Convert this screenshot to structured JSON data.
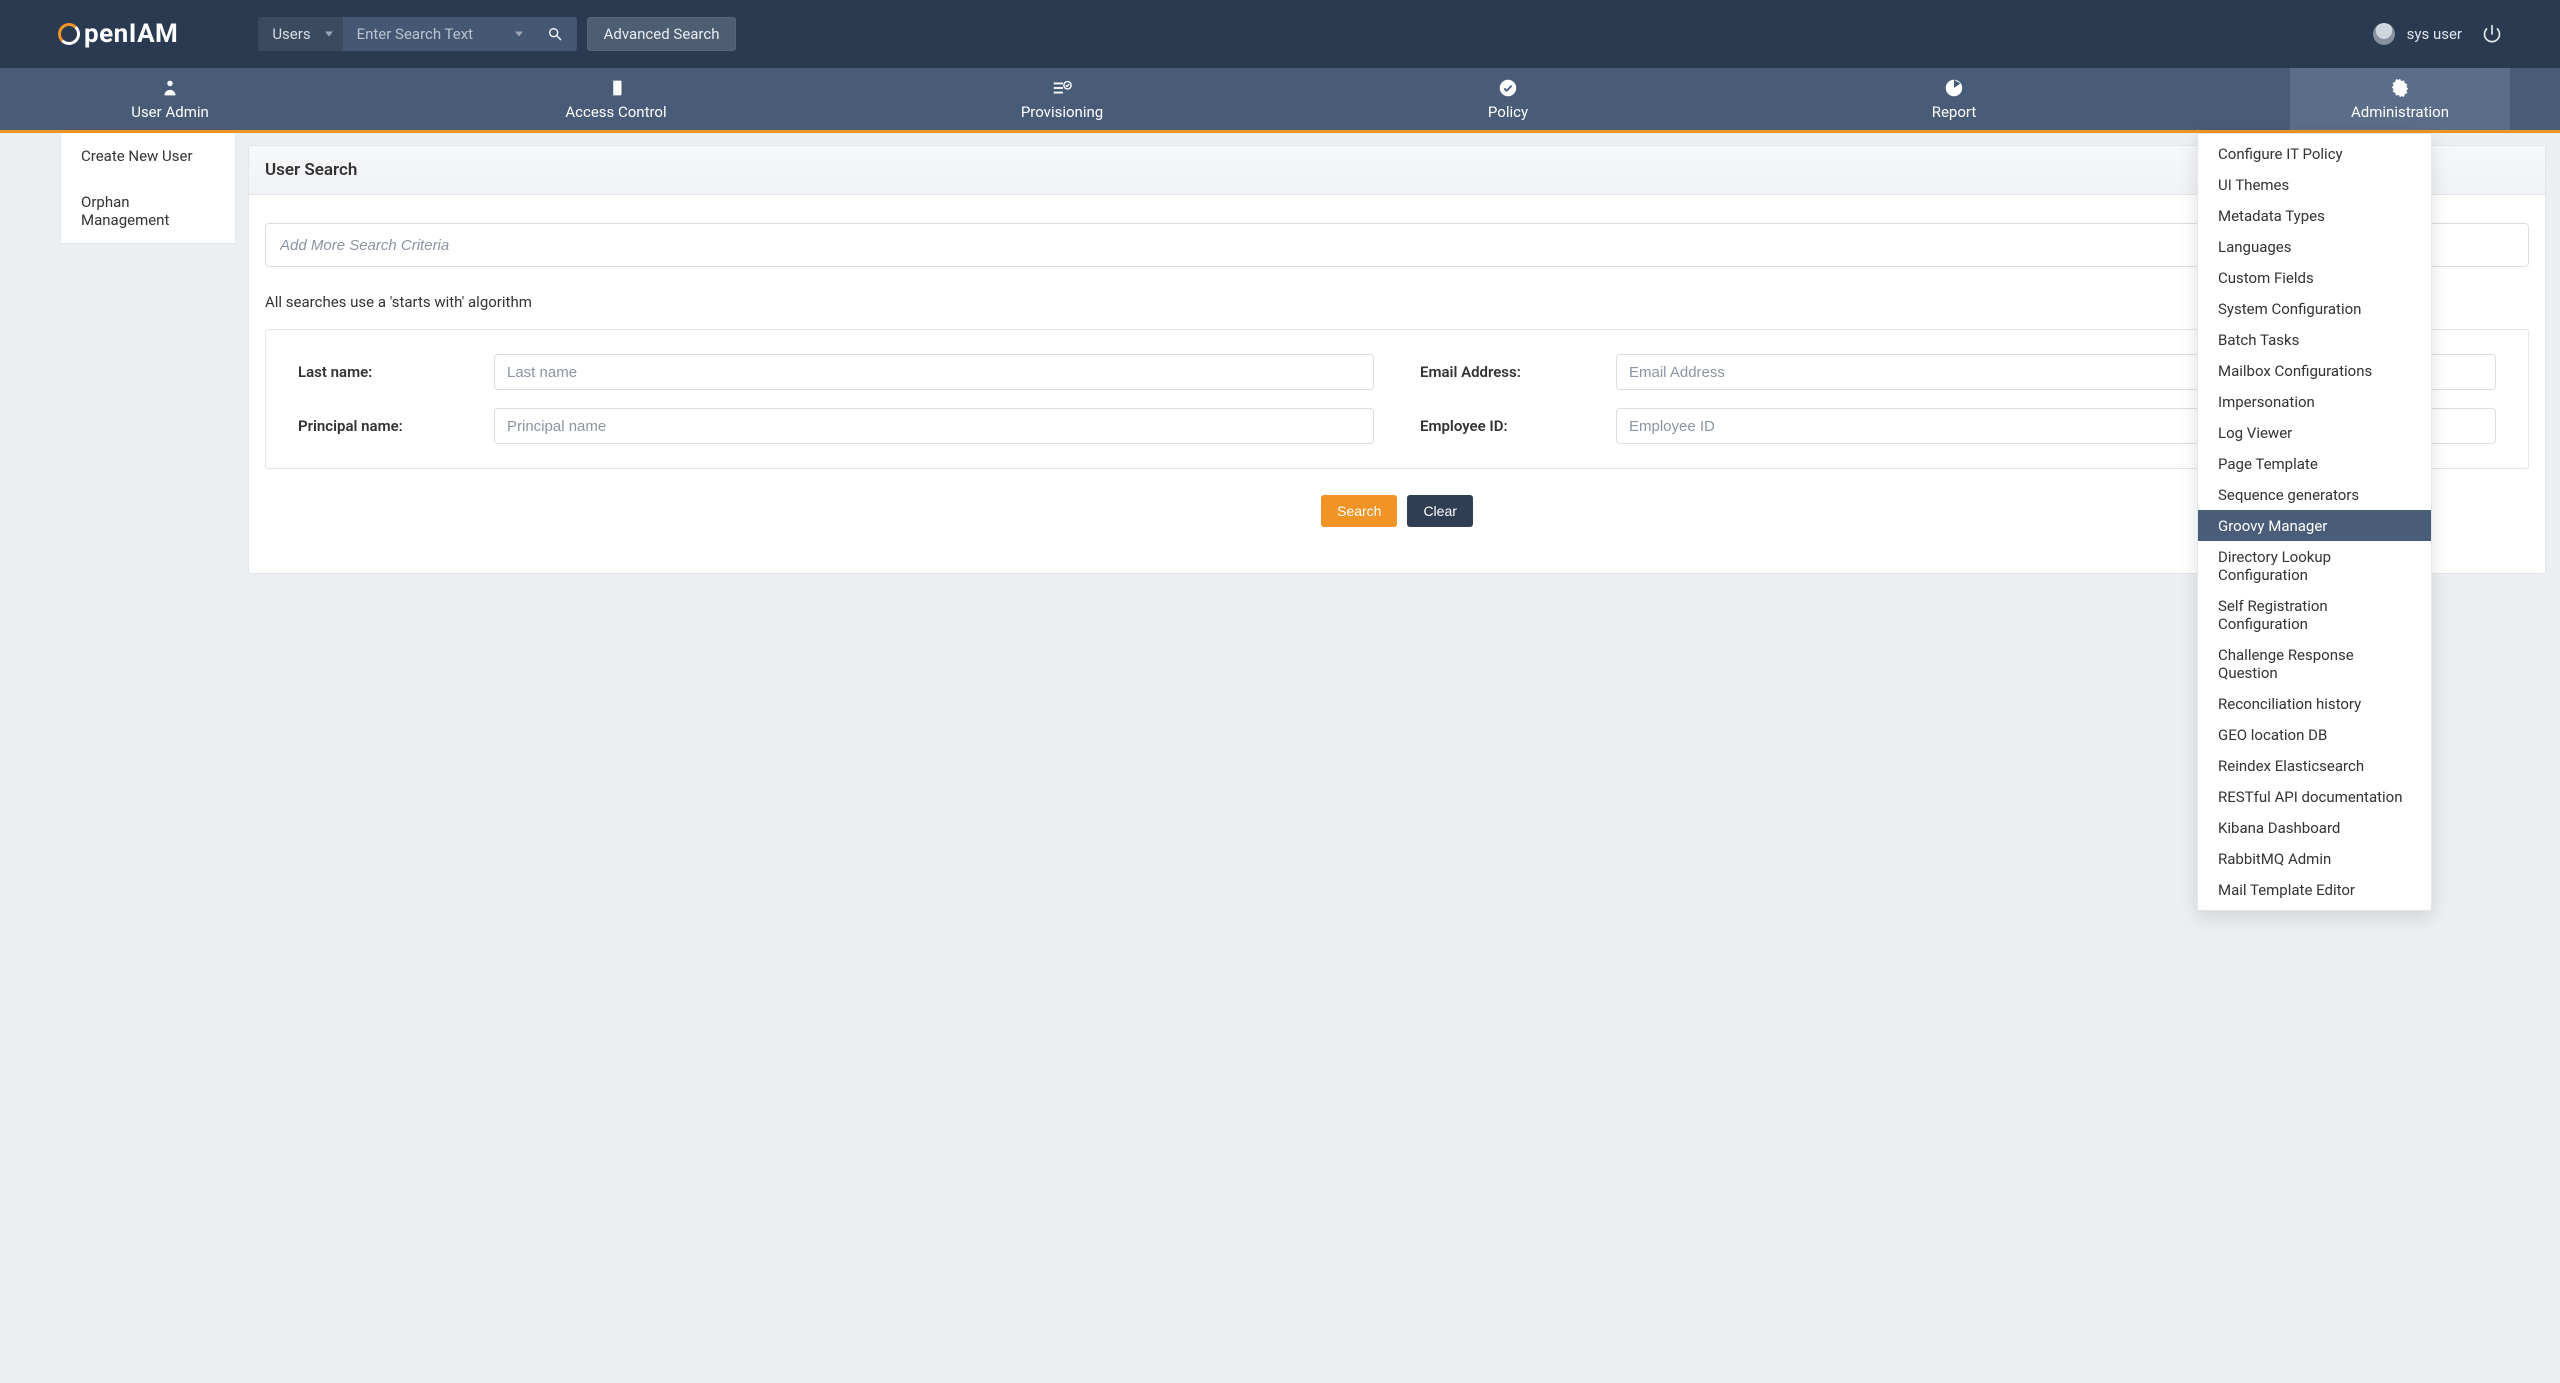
{
  "topbar": {
    "logo_text_1": "pen",
    "logo_text_2": "IAM",
    "entity_select": "Users",
    "search_placeholder": "Enter Search Text",
    "advanced_search": "Advanced Search",
    "username": "sys user"
  },
  "nav": [
    {
      "label": "User Admin",
      "icon": "user"
    },
    {
      "label": "Access Control",
      "icon": "book"
    },
    {
      "label": "Provisioning",
      "icon": "checklist"
    },
    {
      "label": "Policy",
      "icon": "check-circle"
    },
    {
      "label": "Report",
      "icon": "pie"
    },
    {
      "label": "Administration",
      "icon": "gear",
      "active": true
    }
  ],
  "sidebar": {
    "items": [
      {
        "label": "Create New User"
      },
      {
        "label": "Orphan Management"
      }
    ]
  },
  "page": {
    "title": "User Search",
    "criteria_placeholder": "Add More Search Criteria",
    "hint": "All searches use a 'starts with' algorithm",
    "fields": {
      "last_name_label": "Last name:",
      "last_name_placeholder": "Last name",
      "email_label": "Email Address:",
      "email_placeholder": "Email Address",
      "principal_label": "Principal name:",
      "principal_placeholder": "Principal name",
      "employee_label": "Employee ID:",
      "employee_placeholder": "Employee ID"
    },
    "actions": {
      "search": "Search",
      "clear": "Clear"
    }
  },
  "dropdown": {
    "items": [
      "Configure IT Policy",
      "UI Themes",
      "Metadata Types",
      "Languages",
      "Custom Fields",
      "System Configuration",
      "Batch Tasks",
      "Mailbox Configurations",
      "Impersonation",
      "Log Viewer",
      "Page Template",
      "Sequence generators",
      "Groovy Manager",
      "Directory Lookup Configuration",
      "Self Registration Configuration",
      "Challenge Response Question",
      "Reconciliation history",
      "GEO location DB",
      "Reindex Elasticsearch",
      "RESTful API documentation",
      "Kibana Dashboard",
      "RabbitMQ Admin",
      "Mail Template Editor"
    ],
    "highlighted_index": 12
  }
}
